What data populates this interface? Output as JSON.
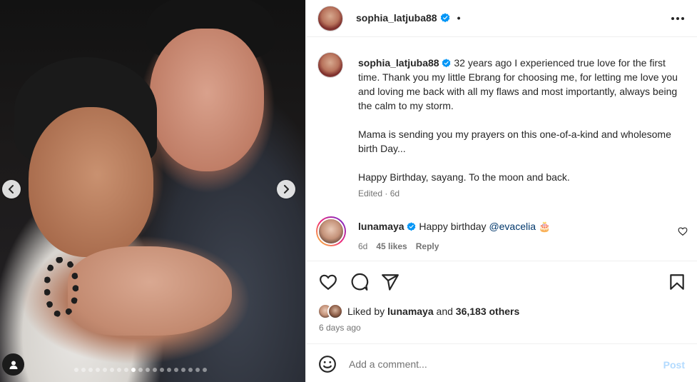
{
  "post": {
    "username": "sophia_latjuba88",
    "header_separator": "•",
    "caption": {
      "username": "sophia_latjuba88",
      "line1": "32 years ago I experienced true love for the first time. Thank you my little Ebrang for choosing me, for letting me love you and loving me back with all my flaws and most importantly, always being the calm to my storm.",
      "line2": "Mama is sending you my prayers on this one-of-a-kind and wholesome birth Day...",
      "line3": "Happy Birthday, sayang. To the moon and back."
    },
    "caption_meta": "Edited · 6d",
    "comment": {
      "username": "lunamaya",
      "text": "Happy birthday",
      "mention": "@evacelia",
      "emoji": "🎂",
      "time": "6d",
      "likes": "45 likes",
      "reply_label": "Reply"
    },
    "likes": {
      "prefix": "Liked by",
      "user": "lunamaya",
      "and": "and",
      "others": "36,183 others"
    },
    "time_ago": "6 days ago",
    "add_comment": {
      "placeholder": "Add a comment...",
      "post_label": "Post"
    }
  },
  "carousel": {
    "dot_count": 19,
    "active_index": 8
  },
  "colors": {
    "verified": "#0095f6",
    "post_button_disabled": "#b3dbff",
    "mention": "#00376b",
    "muted": "#737373"
  },
  "icons": [
    "chevron-left-icon",
    "chevron-right-icon",
    "user-tag-icon",
    "verified-badge-icon",
    "more-icon",
    "heart-icon",
    "comment-icon",
    "share-icon",
    "bookmark-icon",
    "emoji-icon"
  ]
}
